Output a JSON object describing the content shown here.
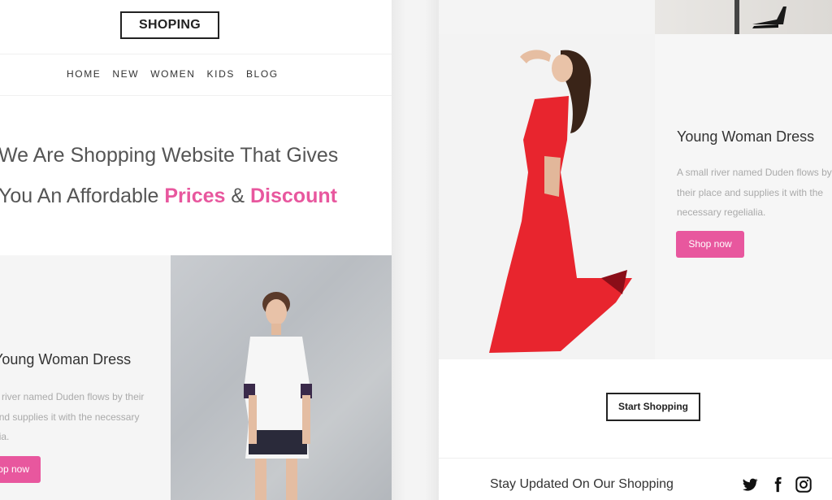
{
  "left": {
    "logo": "SHOPING",
    "nav": [
      "HOME",
      "NEW",
      "WOMEN",
      "KIDS",
      "BLOG"
    ],
    "hero": {
      "line1": "We Are Shopping Website That Gives",
      "line2_prefix": "You An Affordable ",
      "highlight1": "Prices",
      "connector": " & ",
      "highlight2": "Discount"
    },
    "product": {
      "title": "Young Woman Dress",
      "desc": "A small river named Duden flows by their place and supplies it with the necessary regelialia.",
      "button": "Shop now"
    }
  },
  "right": {
    "product": {
      "title": "Young Woman Dress",
      "desc": "A small river named Duden flows by their place and supplies it with the necessary regelialia.",
      "button": "Shop now"
    },
    "start_button": "Start Shopping",
    "stay_updated": "Stay Updated On Our Shopping",
    "social": [
      "twitter-icon",
      "facebook-icon",
      "instagram-icon"
    ]
  },
  "colors": {
    "accent": "#e8579e",
    "text": "#333333",
    "muted": "#aaaaaa"
  }
}
